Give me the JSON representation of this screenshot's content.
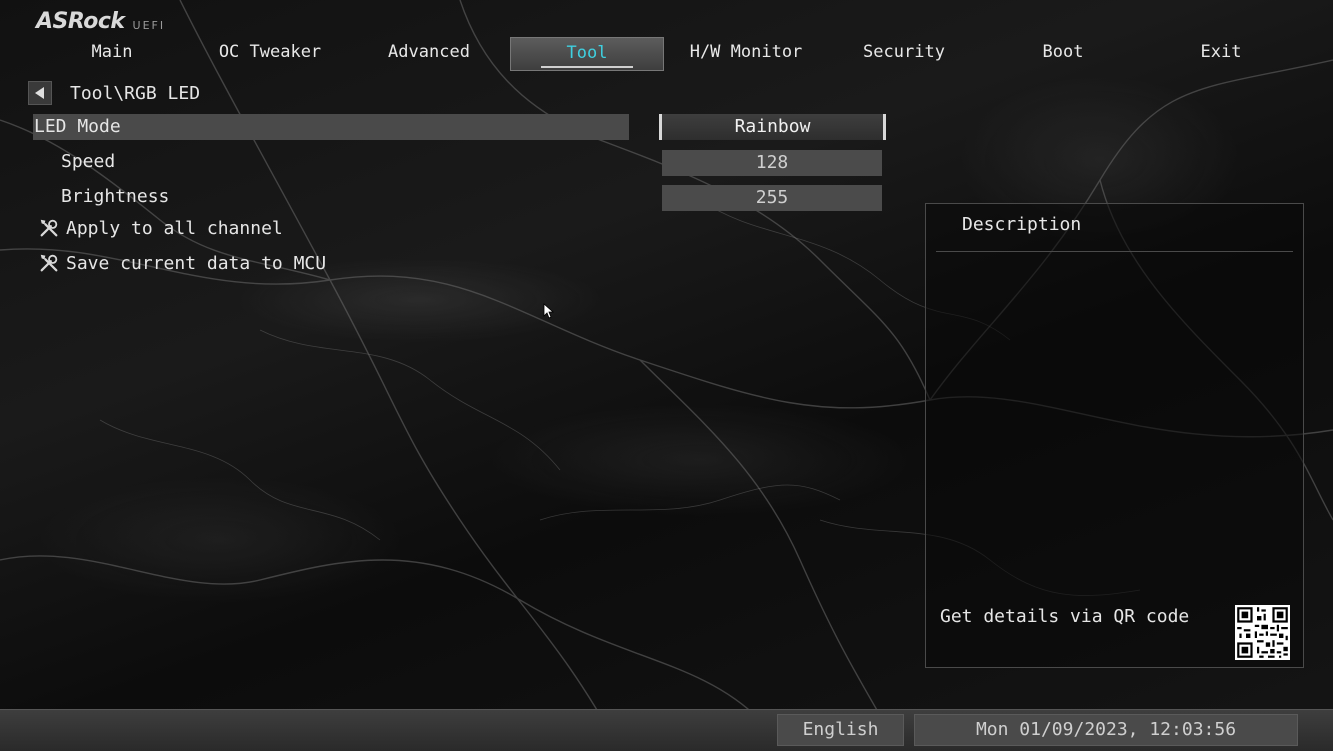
{
  "brand": {
    "logo": "ASRock",
    "sub": "UEFI"
  },
  "tabs": [
    {
      "label": "Main",
      "active": false
    },
    {
      "label": "OC Tweaker",
      "active": false
    },
    {
      "label": "Advanced",
      "active": false
    },
    {
      "label": "Tool",
      "active": true
    },
    {
      "label": "H/W Monitor",
      "active": false
    },
    {
      "label": "Security",
      "active": false
    },
    {
      "label": "Boot",
      "active": false
    },
    {
      "label": "Exit",
      "active": false
    }
  ],
  "breadcrumb": {
    "path": "Tool\\RGB LED",
    "back_icon": "back-arrow-icon"
  },
  "settings": {
    "led_mode": {
      "label": "LED Mode",
      "value": "Rainbow"
    },
    "speed": {
      "label": "Speed",
      "value": "128"
    },
    "brightness": {
      "label": "Brightness",
      "value": "255"
    }
  },
  "actions": [
    {
      "label": "Apply to all channel",
      "icon": "wrench-screwdriver-icon"
    },
    {
      "label": "Save current data to MCU",
      "icon": "wrench-screwdriver-icon"
    }
  ],
  "description": {
    "title": "Description",
    "qr_label": "Get details via QR code"
  },
  "footer": {
    "language": "English",
    "datetime": "Mon 01/09/2023, 12:03:56"
  },
  "colors": {
    "active_tab_text": "#3fd0e0",
    "highlight_row": "#4a4a4a"
  }
}
